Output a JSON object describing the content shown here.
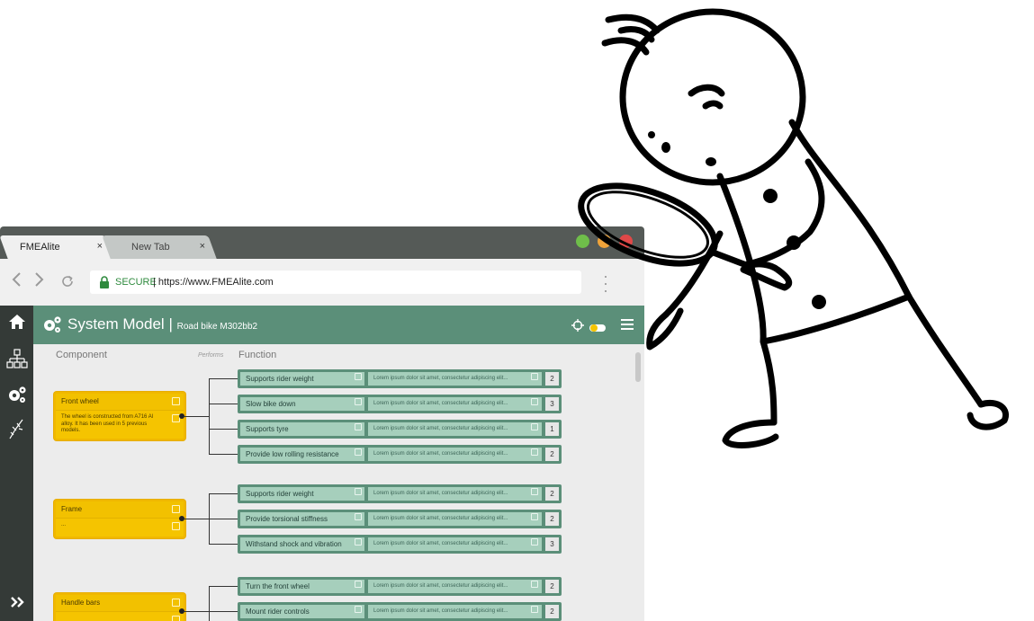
{
  "browser": {
    "tabs": [
      {
        "label": "FMEAlite",
        "close": "×"
      },
      {
        "label": "New Tab",
        "close": "×"
      }
    ],
    "secure_label": "SECURE",
    "url": "| https://www.FMEAlite.com"
  },
  "app": {
    "title": "System Model",
    "separator": "|",
    "subtitle": "Road bike M302bb2"
  },
  "columns": {
    "component": "Component",
    "performs": "Performs",
    "function": "Function"
  },
  "components": [
    {
      "title": "Front wheel",
      "description": "The wheel is constructed from A716 Al alloy. It has been used in 5 previous models.",
      "functions": [
        {
          "name": "Supports rider weight",
          "desc": "Lorem ipsum dolor sit amet, consectetur adipiscing elit...",
          "count": "2"
        },
        {
          "name": "Slow bike down",
          "desc": "Lorem ipsum dolor sit amet, consectetur adipiscing elit...",
          "count": "3"
        },
        {
          "name": "Supports tyre",
          "desc": "Lorem ipsum dolor sit amet, consectetur adipiscing elit...",
          "count": "1"
        },
        {
          "name": "Provide low rolling resistance",
          "desc": "Lorem ipsum dolor sit amet, consectetur adipiscing elit...",
          "count": "2"
        }
      ]
    },
    {
      "title": "Frame",
      "description": "...",
      "functions": [
        {
          "name": "Supports rider weight",
          "desc": "Lorem ipsum dolor sit amet, consectetur adipiscing elit...",
          "count": "2"
        },
        {
          "name": "Provide torsional stiffness",
          "desc": "Lorem ipsum dolor sit amet, consectetur adipiscing elit...",
          "count": "2"
        },
        {
          "name": "Withstand shock and vibration",
          "desc": "Lorem ipsum dolor sit amet, consectetur adipiscing elit...",
          "count": "3"
        }
      ]
    },
    {
      "title": "Handle bars",
      "description": "",
      "functions": [
        {
          "name": "Turn the front wheel",
          "desc": "Lorem ipsum dolor sit amet, consectetur adipiscing elit...",
          "count": "2"
        },
        {
          "name": "Mount rider controls",
          "desc": "Lorem ipsum dolor sit amet, consectetur adipiscing elit...",
          "count": "2"
        }
      ]
    }
  ],
  "colors": {
    "accent": "#5b8f79",
    "component": "#f5c400",
    "sidebar": "#343a37"
  },
  "icons": {
    "sidebar": [
      "home-icon",
      "hierarchy-icon",
      "gears-icon",
      "fishbone-icon"
    ],
    "expand": "double-chevron-icon",
    "header": [
      "crosshair-icon",
      "toggle-icon",
      "hamburger-menu-icon"
    ]
  }
}
